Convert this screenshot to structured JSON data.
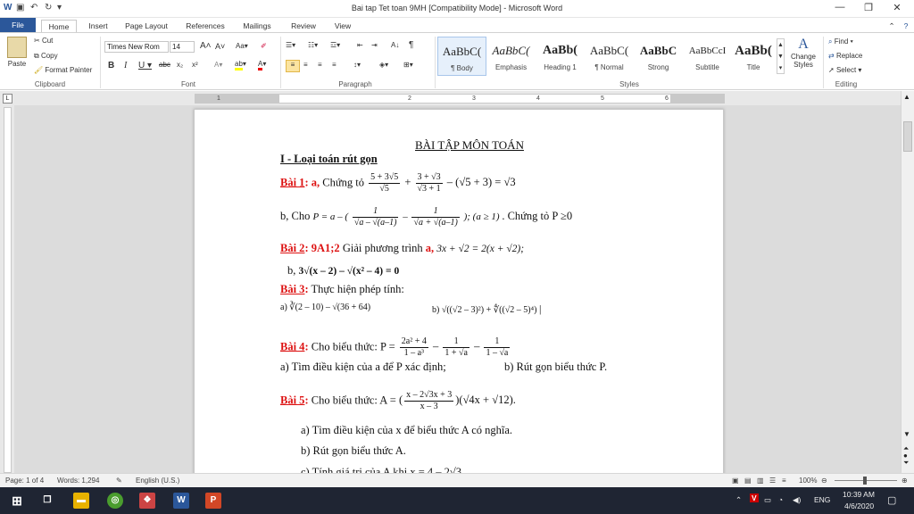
{
  "window": {
    "title": "Bai tap Tet toan 9MH [Compatibility Mode]  -  Microsoft Word",
    "minimize_glyph": "—",
    "restore_glyph": "❐",
    "close_glyph": "✕"
  },
  "tabs": [
    "File",
    "Home",
    "Insert",
    "Page Layout",
    "References",
    "Mailings",
    "Review",
    "View"
  ],
  "ribbon": {
    "clipboard": {
      "paste": "Paste",
      "cut": "Cut",
      "copy": "Copy",
      "format_painter": "Format Painter",
      "label": "Clipboard"
    },
    "font": {
      "name": "Times New Rom",
      "size": "14",
      "label": "Font"
    },
    "paragraph": {
      "label": "Paragraph"
    },
    "styles": {
      "label": "Styles",
      "items": [
        {
          "preview": "AaBbC(",
          "name": "¶ Body"
        },
        {
          "preview": "AaBbC(",
          "name": "Emphasis"
        },
        {
          "preview": "AaBb(",
          "name": "Heading 1"
        },
        {
          "preview": "AaBbC(",
          "name": "¶ Normal"
        },
        {
          "preview": "AaBbC",
          "name": "Strong"
        },
        {
          "preview": "AaBbCcI",
          "name": "Subtitle"
        },
        {
          "preview": "AaBb(",
          "name": "Title"
        }
      ],
      "change_styles": "Change Styles"
    },
    "editing": {
      "find": "Find",
      "replace": "Replace",
      "select": "Select",
      "label": "Editing"
    }
  },
  "ruler": {
    "numbers": [
      "1",
      "2",
      "3",
      "4",
      "5",
      "6"
    ]
  },
  "document": {
    "title": "BÀI TẬP  MÔN TOÁN",
    "section1": "I - Loại toán rút gọn",
    "bai1": {
      "label": "Bài 1",
      "a_label": "a,",
      "a_text": "Chứng tỏ",
      "b_text": "b,  Cho",
      "b_tail": ". Chứng tỏ  P  ≥0"
    },
    "bai2": {
      "label": "Bài 2",
      "code": "9A1;2",
      "text": "Giải phương trình",
      "a_label": "a,",
      "b_text": "b,"
    },
    "bai3": {
      "label": "Bài 3",
      "text": "Thực hiện phép tính:",
      "a": "a)",
      "b": "b)"
    },
    "bai4": {
      "label": "Bài 4",
      "text": "Cho biểu thức: P =",
      "a": "a) Tìm điều kiện của a để  P xác định;",
      "b": "b) Rút gọn biểu thức P."
    },
    "bai5": {
      "label": "Bài 5",
      "text": "Cho biểu thức:  A =",
      "a": "a) Tìm điều kiện của x để biểu thức A có nghĩa.",
      "b": "b) Rút gọn biểu thức A.",
      "c": "c) Tính giá trị của A khi  x = 4 – 2√3"
    }
  },
  "status": {
    "page": "Page: 1 of 4",
    "words": "Words: 1,294",
    "lang": "English (U.S.)",
    "zoom": "100%"
  },
  "taskbar": {
    "lang": "ENG",
    "time": "10:39 AM",
    "date": "4/6/2020"
  }
}
